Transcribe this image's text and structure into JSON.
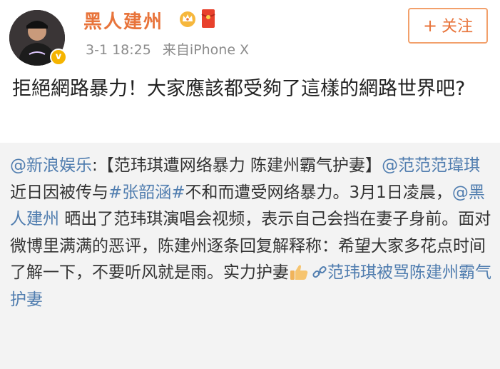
{
  "post": {
    "username": "黑人建州",
    "time": "3-1 18:25",
    "source": "来自iPhone X",
    "follow_label": "关注",
    "content": "拒絕網路暴力！大家應該都受夠了這樣的網路世界吧?"
  },
  "repost": {
    "author": "@新浪娱乐",
    "colon": ":",
    "text1": "【范玮琪遭网络暴力 陈建州霸气护妻】",
    "mention1": "@范范范瑋琪",
    "text2": " 近日因被传与",
    "hashtag": "#张韶涵#",
    "text3": "不和而遭受网络暴力。3月1日凌晨，",
    "mention2": "@黑人建州",
    "text4": " 晒出了范玮琪演唱会视频，表示自己会挡在妻子身前。面对微博里满满的恶评，陈建州逐条回复解释称：希望大家多花点时间了解一下，不要听风就是雨。实力护妻",
    "link_text": "范玮琪被骂陈建州霸气护妻"
  },
  "icons": {
    "avatar": "user-avatar",
    "verified": "verified-badge-icon",
    "crown": "crown-icon",
    "red_packet": "red-packet-icon",
    "thumbs_up": "thumbs-up-emoji",
    "link": "link-icon"
  },
  "colors": {
    "username": "#e8743b",
    "link": "#507daf",
    "repost_bg": "#f3f3f3",
    "meta": "#8c8c8c"
  }
}
